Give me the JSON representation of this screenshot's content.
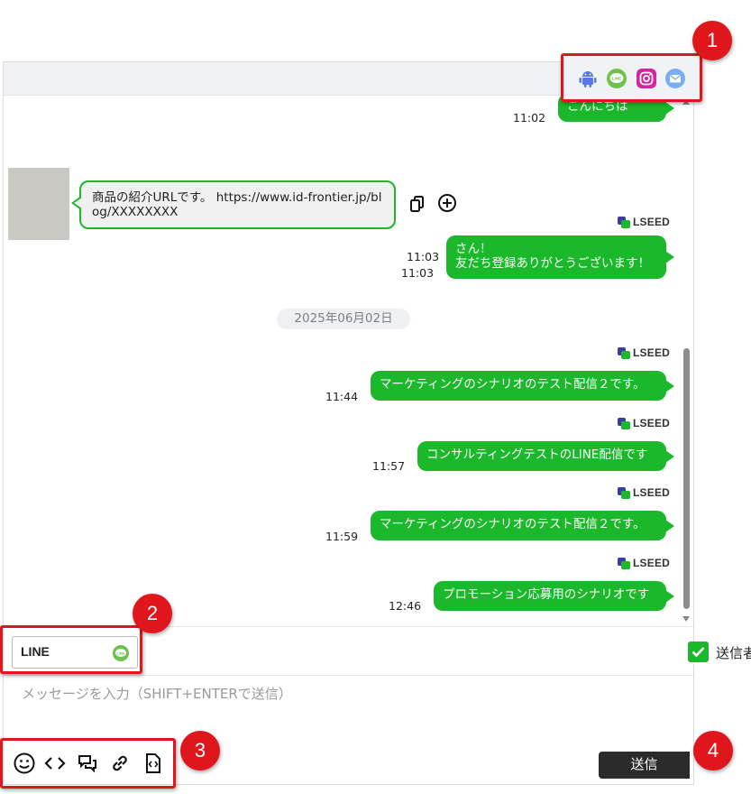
{
  "channels": {
    "icons": [
      "android-icon",
      "line-icon",
      "instagram-icon",
      "mail-icon"
    ],
    "line_badge_text": "LINE"
  },
  "messages": [
    {
      "direction": "out",
      "text": "こんにちは",
      "time": "11:02",
      "sender_logo": false
    },
    {
      "direction": "in",
      "text": "商品の紹介URLです。 https://www.id-frontier.jp/blog/XXXXXXXX",
      "time": "11:03"
    },
    {
      "direction": "out",
      "lines": [
        "さん！",
        "友だち登録ありがとうございます！"
      ],
      "time": "11:03",
      "sender_logo": true
    },
    {
      "direction": "out",
      "text": "マーケティングのシナリオのテスト配信２です。",
      "time": "11:44",
      "sender_logo": true
    },
    {
      "direction": "out",
      "text": "コンサルティングテストのLINE配信です",
      "time": "11:57",
      "sender_logo": true
    },
    {
      "direction": "out",
      "text": "マーケティングのシナリオのテスト配信２です。",
      "time": "11:59",
      "sender_logo": true
    },
    {
      "direction": "out",
      "text": "プロモーション応募用のシナリオです",
      "time": "12:46",
      "sender_logo": true
    }
  ],
  "date_separator": "2025年06月02日",
  "sender_logo_text": "LSEED",
  "channel_select": {
    "value": "LINE"
  },
  "sender_name_checkbox": {
    "label": "送信者名",
    "checked": true
  },
  "message_input": {
    "placeholder": "メッセージを入力（SHIFT+ENTERで送信）",
    "value": ""
  },
  "send_button": "送信",
  "callouts": [
    "1",
    "2",
    "3",
    "4"
  ],
  "colors": {
    "accent_green": "#1ab82a",
    "callout_red": "#e0161d",
    "send_button_bg": "#2b2b2b"
  }
}
